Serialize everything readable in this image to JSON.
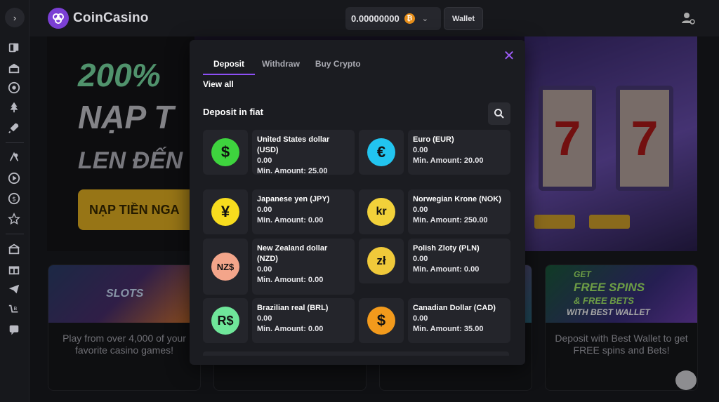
{
  "header": {
    "logo_text": "CoinCasino",
    "balance": "0.00000000",
    "wallet_label": "Wallet"
  },
  "banner": {
    "line1": "200%",
    "line2": "NẠP T",
    "line3": "LEN ĐẾN",
    "button": "NẠP TIỀN NGA"
  },
  "cards": [
    {
      "image_label": "SLOTS",
      "text": "Play from over 4,000 of your favorite casino games!"
    },
    {},
    {},
    {
      "image_line1": "GET",
      "image_line2": "FREE SPINS",
      "image_line3": "& FREE BETS",
      "image_line4": "WITH BEST WALLET",
      "text": "Deposit with Best Wallet to get FREE spins and Bets!"
    }
  ],
  "modal": {
    "tabs": [
      "Deposit",
      "Withdraw",
      "Buy Crypto"
    ],
    "active_tab": "Deposit",
    "view_all": "View all",
    "section_title": "Deposit in fiat",
    "accent_color": "#8d4ff5",
    "currencies": [
      {
        "symbol": "$",
        "name": "United States dollar (USD)",
        "balance": "0.00",
        "min": "Min. Amount: 25.00",
        "color": "#3ed43e"
      },
      {
        "symbol": "€",
        "name": "Euro (EUR)",
        "balance": "0.00",
        "min": "Min. Amount: 20.00",
        "color": "#22c4ef"
      },
      {
        "symbol": "¥",
        "name": "Japanese yen (JPY)",
        "balance": "0.00",
        "min": "Min. Amount: 0.00",
        "color": "#f7dc1e"
      },
      {
        "symbol": "kr",
        "name": "Norwegian Krone (NOK)",
        "balance": "0.00",
        "min": "Min. Amount: 250.00",
        "color": "#f2d13a"
      },
      {
        "symbol": "NZ$",
        "name": "New Zealand dollar (NZD)",
        "balance": "0.00",
        "min": "Min. Amount: 0.00",
        "color": "#f3a58a"
      },
      {
        "symbol": "zł",
        "name": "Polish Zloty (PLN)",
        "balance": "0.00",
        "min": "Min. Amount: 0.00",
        "color": "#f0c93a"
      },
      {
        "symbol": "R$",
        "name": "Brazilian real (BRL)",
        "balance": "0.00",
        "min": "Min. Amount: 0.00",
        "color": "#6fe69a"
      },
      {
        "symbol": "$",
        "name": "Canadian Dollar (CAD)",
        "balance": "0.00",
        "min": "Min. Amount: 35.00",
        "color": "#f29a1c"
      }
    ]
  }
}
